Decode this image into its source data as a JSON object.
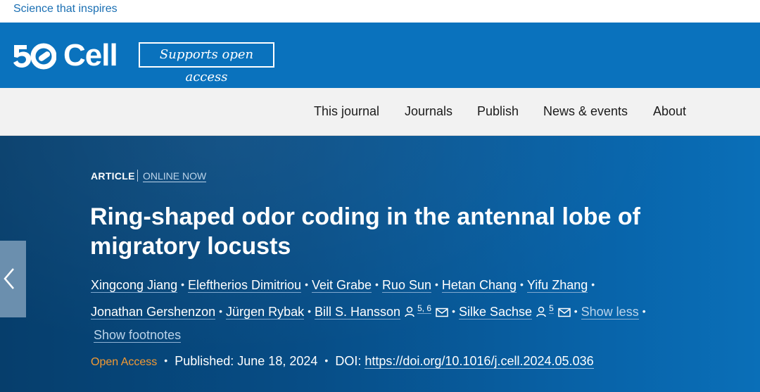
{
  "topbar": {
    "tagline": "Science that inspires"
  },
  "brand": {
    "logo_number": "50",
    "logo_name": "Cell",
    "badge": "Supports open access",
    "color": "#0a72bd"
  },
  "nav": {
    "items": [
      "This journal",
      "Journals",
      "Publish",
      "News & events",
      "About"
    ]
  },
  "article": {
    "type": "ARTICLE",
    "status": "ONLINE NOW",
    "title_line1": "Ring-shaped odor coding in the antennal lobe of",
    "title_line2": "migratory locusts",
    "authors": [
      "Xingcong Jiang",
      "Eleftherios Dimitriou",
      "Veit Grabe",
      "Ruo Sun",
      "Hetan Chang",
      "Yifu Zhang",
      "Jonathan Gershenzon",
      "Jürgen Rybak",
      "Bill S. Hansson",
      "Silke Sachse"
    ],
    "hansson_sup": "5, 6",
    "sachse_sup": "5",
    "show_less": "Show less",
    "show_footnotes": "Show footnotes",
    "access": "Open Access",
    "published": "Published: June 18, 2024",
    "doi_label": "DOI:",
    "doi": "https://doi.org/10.1016/j.cell.2024.05.036",
    "access_color": "#f39a33"
  },
  "icons": [
    "person-icon",
    "mail-icon",
    "chevron-left-icon"
  ]
}
